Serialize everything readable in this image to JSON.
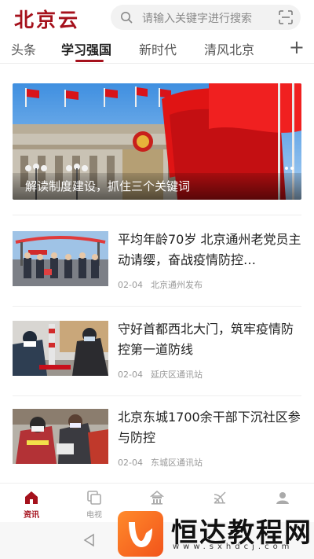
{
  "header": {
    "logo": "北京云",
    "search_placeholder": "请输入关键字进行搜索",
    "search_icon": "search-icon",
    "scan_icon": "scan-icon"
  },
  "tabs": [
    {
      "label": "头条",
      "active": false
    },
    {
      "label": "学习强国",
      "active": true
    },
    {
      "label": "新时代",
      "active": false
    },
    {
      "label": "清风北京",
      "active": false
    }
  ],
  "tabs_add_icon": "plus-icon",
  "banner": {
    "caption": "解读制度建设，抓住三个关键词"
  },
  "news": [
    {
      "title": "平均年龄70岁 北京通州老党员主动请缨，奋战疫情防控…",
      "date": "02-04",
      "source": "北京通州发布"
    },
    {
      "title": "守好首都西北大门，筑牢疫情防控第一道防线",
      "date": "02-04",
      "source": "延庆区通讯站"
    },
    {
      "title": "北京东城1700余干部下沉社区参与防控",
      "date": "02-04",
      "source": "东城区通讯站"
    }
  ],
  "bottom_nav": [
    {
      "label": "资讯",
      "icon": "home-icon",
      "active": true
    },
    {
      "label": "电视",
      "icon": "tv-icon",
      "active": false
    },
    {
      "label": "",
      "icon": "temple-icon",
      "active": false
    },
    {
      "label": "",
      "icon": "broadcast-icon",
      "active": false
    },
    {
      "label": "",
      "icon": "user-icon",
      "active": false
    }
  ],
  "watermark": {
    "title": "恒达教程网",
    "url": "www.sxhdcj.com"
  },
  "colors": {
    "brand": "#a5111c",
    "watermark_orange": "#f2541b"
  }
}
